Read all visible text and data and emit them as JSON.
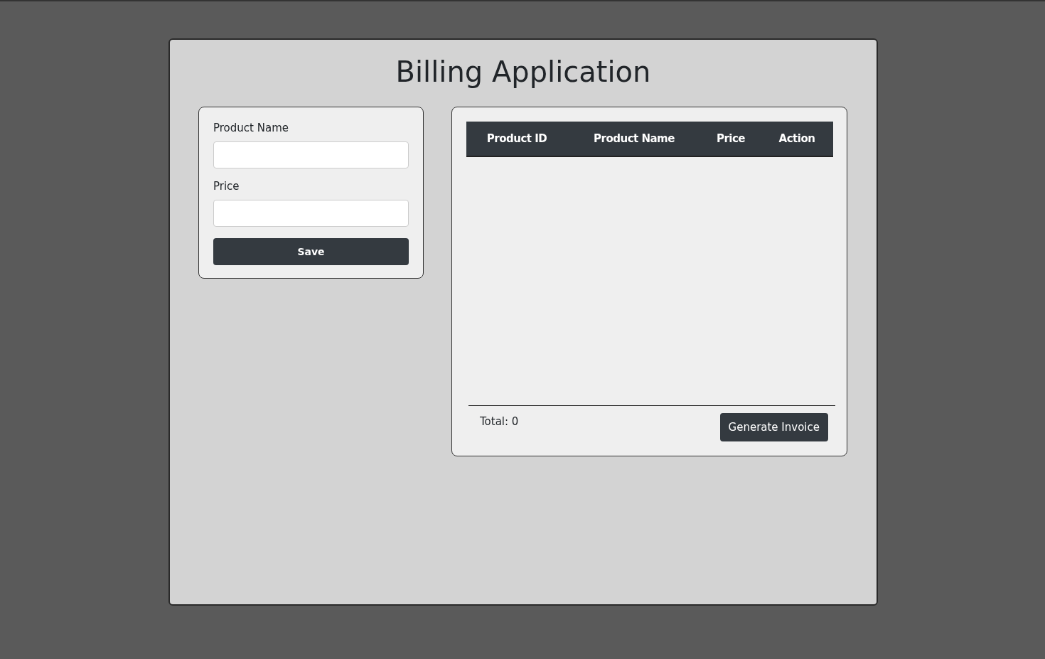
{
  "title": "Billing Application",
  "form": {
    "fields": [
      {
        "label": "Product Name"
      },
      {
        "label": "Price"
      }
    ],
    "save_button": "Save"
  },
  "table": {
    "columns": [
      "Product ID",
      "Product Name",
      "Price",
      "Action"
    ]
  },
  "footer": {
    "total": "Total: 0",
    "button": "Generate Invoice"
  }
}
